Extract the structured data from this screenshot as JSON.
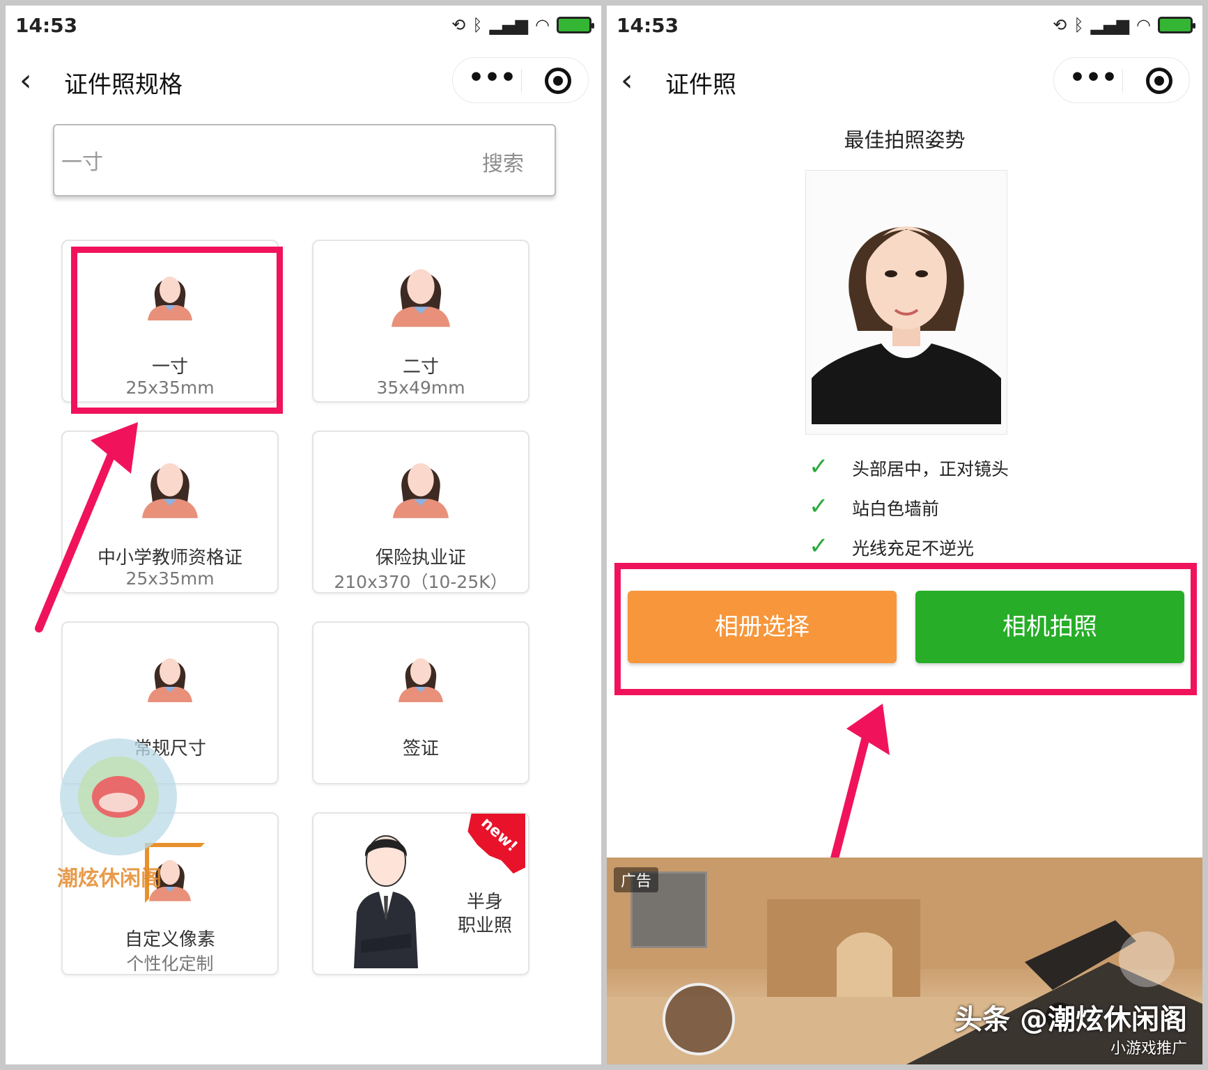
{
  "status_bar": {
    "time": "14:53"
  },
  "left": {
    "nav_title": "证件照规格",
    "search": {
      "placeholder": "一寸",
      "button": "搜索"
    },
    "cards": [
      {
        "name": "一寸",
        "size": "25x35mm"
      },
      {
        "name": "二寸",
        "size": "35x49mm"
      },
      {
        "name": "中小学教师资格证",
        "size": "25x35mm"
      },
      {
        "name": "保险执业证",
        "size": "210x370（10-25K）"
      },
      {
        "name": "常规尺寸",
        "size": ""
      },
      {
        "name": "签证",
        "size": ""
      },
      {
        "name": "自定义像素",
        "size": "个性化定制"
      },
      {
        "name": "半身\n职业照",
        "badge": "new!"
      }
    ]
  },
  "right": {
    "nav_title": "证件照",
    "pose_title": "最佳拍照姿势",
    "tips": [
      "头部居中，正对镜头",
      "站白色墙前",
      "光线充足不逆光"
    ],
    "btn_album": "相册选择",
    "btn_camera": "相机拍照",
    "ad": {
      "tag": "广告",
      "brand": "头条 @潮炫休闲阁",
      "sub": "小游戏推广"
    }
  },
  "watermark": {
    "text": "潮炫休闲阁"
  },
  "colors": {
    "highlight": "#f0135c",
    "album": "#f7963a",
    "camera": "#27ad28",
    "check": "#2aa83a"
  }
}
